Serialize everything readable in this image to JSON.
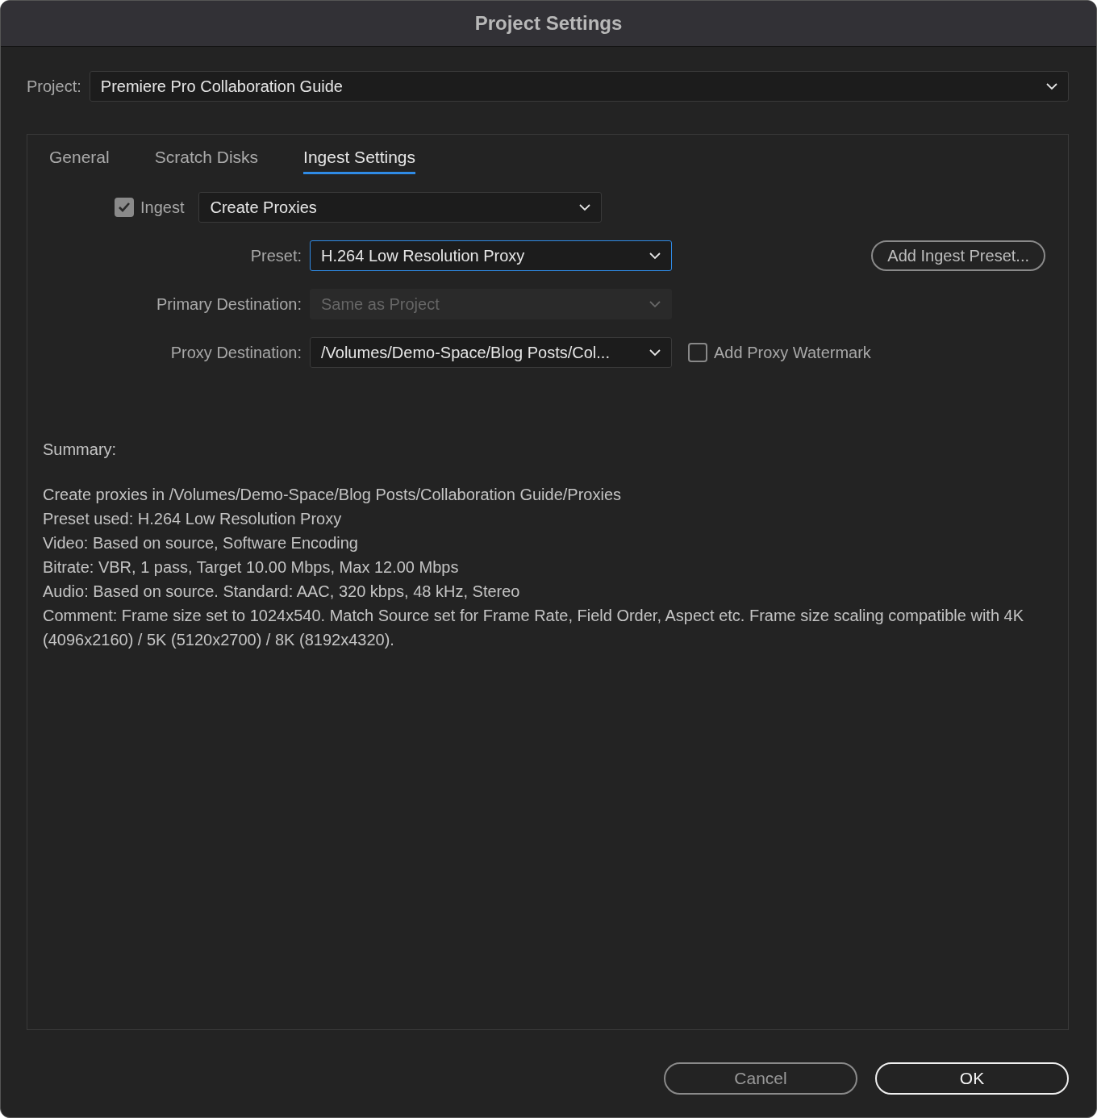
{
  "window": {
    "title": "Project Settings"
  },
  "project": {
    "label": "Project:",
    "value": "Premiere Pro Collaboration Guide"
  },
  "tabs": [
    {
      "label": "General",
      "selected": false
    },
    {
      "label": "Scratch Disks",
      "selected": false
    },
    {
      "label": "Ingest Settings",
      "selected": true
    }
  ],
  "ingest": {
    "label": "Ingest",
    "checked": true,
    "value": "Create Proxies"
  },
  "fields": [
    {
      "label": "Preset:",
      "value": "H.264 Low Resolution Proxy",
      "focused": true,
      "disabled": false
    },
    {
      "label": "Primary Destination:",
      "value": "Same as Project",
      "focused": false,
      "disabled": true
    },
    {
      "label": "Proxy Destination:",
      "value": "/Volumes/Demo-Space/Blog Posts/Col...",
      "focused": false,
      "disabled": false
    }
  ],
  "add_preset_button": "Add Ingest Preset...",
  "watermark": {
    "label": "Add Proxy Watermark",
    "checked": false
  },
  "summary": {
    "heading": "Summary:",
    "lines": [
      "Create proxies in /Volumes/Demo-Space/Blog Posts/Collaboration Guide/Proxies",
      "Preset used: H.264 Low Resolution Proxy",
      "Video: Based on source, Software Encoding",
      "Bitrate: VBR, 1 pass, Target 10.00 Mbps, Max 12.00 Mbps",
      "Audio: Based on source. Standard: AAC, 320 kbps, 48 kHz, Stereo",
      "Comment: Frame size set to 1024x540. Match Source set for Frame Rate, Field Order, Aspect etc. Frame size scaling compatible with 4K (4096x2160) / 5K (5120x2700) / 8K (8192x4320)."
    ]
  },
  "buttons": [
    {
      "label": "Cancel",
      "kind": "secondary"
    },
    {
      "label": "OK",
      "kind": "primary"
    }
  ]
}
